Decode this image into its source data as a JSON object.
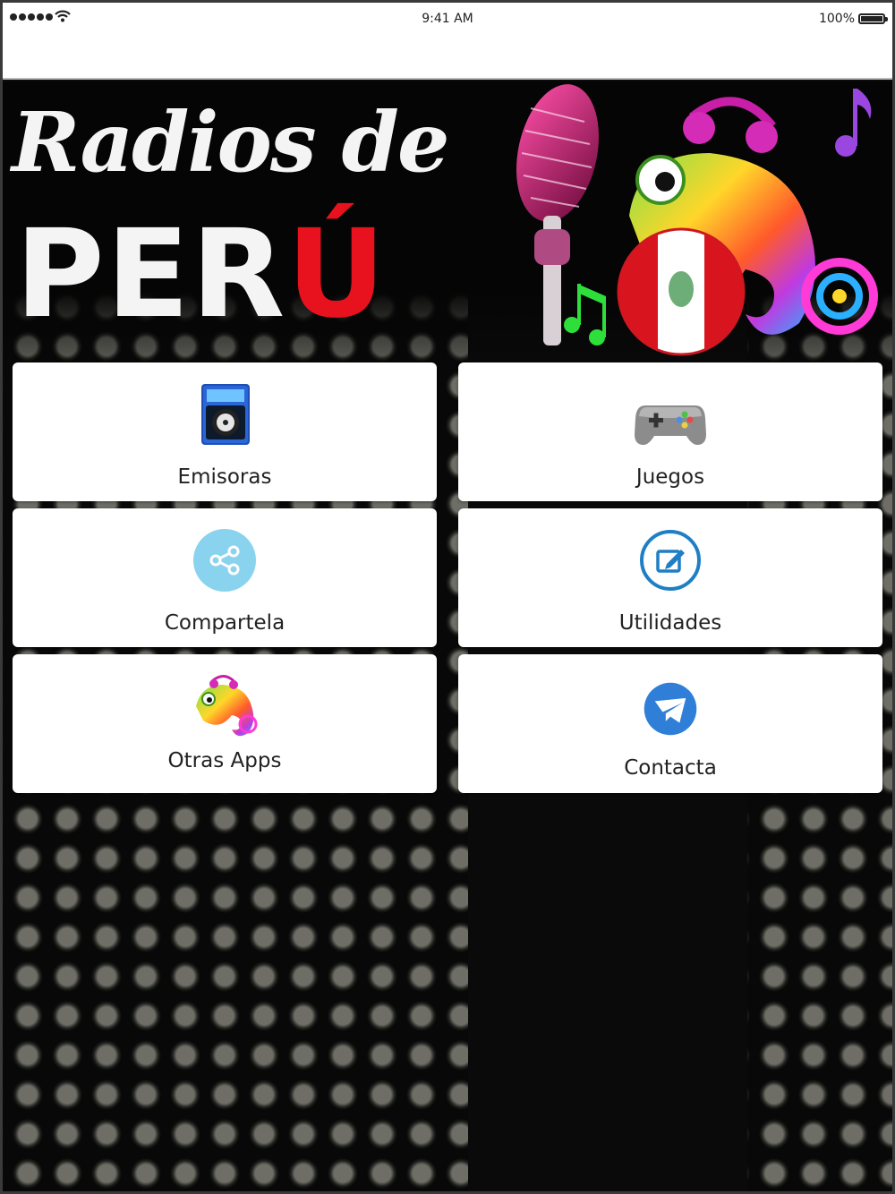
{
  "status_bar": {
    "time": "9:41 AM",
    "battery": "100%"
  },
  "banner": {
    "title_line1": "Radios de",
    "title_line2_white": "PER",
    "title_line2_red": "Ú"
  },
  "menu": {
    "items": [
      {
        "label": "Emisoras",
        "icon": "radio-icon"
      },
      {
        "label": "Juegos",
        "icon": "gamepad-icon"
      },
      {
        "label": "Compartela",
        "icon": "share-icon"
      },
      {
        "label": "Utilidades",
        "icon": "edit-icon"
      },
      {
        "label": "Otras Apps",
        "icon": "chameleon-icon"
      },
      {
        "label": "Contacta",
        "icon": "mail-icon"
      }
    ]
  },
  "colors": {
    "accent_red": "#e8121e",
    "share_blue": "#8ad3ee",
    "edit_blue": "#1f7fc4",
    "mail_blue": "#2f7fd9"
  }
}
